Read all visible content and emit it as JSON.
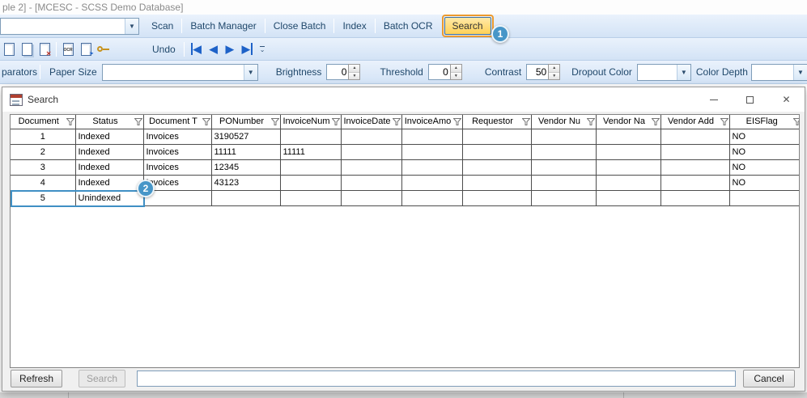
{
  "main_window": {
    "title": "ple 2] - [MCESC - SCSS Demo Database]"
  },
  "toolbar_top": {
    "batch_combo_value": "",
    "scan": "Scan",
    "batch_manager": "Batch Manager",
    "close_batch": "Close Batch",
    "index": "Index",
    "batch_ocr": "Batch OCR",
    "search": "Search"
  },
  "toolbar_pages": {
    "icons": [
      "new-page-icon",
      "insert-page-icon",
      "delete-page-icon",
      "ocr-page-icon",
      "export-page-icon",
      "key-icon"
    ],
    "ocr_icon_label": "OCR",
    "undo": "Undo"
  },
  "toolbar_settings": {
    "separators_label": "parators",
    "paper_size_label": "Paper Size",
    "paper_size_value": "",
    "brightness_label": "Brightness",
    "brightness_value": "0",
    "threshold_label": "Threshold",
    "threshold_value": "0",
    "contrast_label": "Contrast",
    "contrast_value": "50",
    "dropout_color_label": "Dropout Color",
    "dropout_color_value": "",
    "color_depth_label": "Color Depth",
    "color_depth_value": ""
  },
  "callouts": {
    "one": "1",
    "two": "2"
  },
  "dialog": {
    "title": "Search",
    "grid": {
      "columns": [
        "Document",
        "Status",
        "Document T",
        "PONumber",
        "InvoiceNum",
        "InvoiceDate",
        "InvoiceAmo",
        "Requestor",
        "Vendor Nu",
        "Vendor Na",
        "Vendor Add",
        "EISFlag"
      ],
      "rows": [
        [
          "1",
          "Indexed",
          "Invoices",
          "3190527",
          "",
          "",
          "",
          "",
          "",
          "",
          "",
          "NO"
        ],
        [
          "2",
          "Indexed",
          "Invoices",
          "11111",
          "11111",
          "",
          "",
          "",
          "",
          "",
          "",
          "NO"
        ],
        [
          "3",
          "Indexed",
          "Invoices",
          "12345",
          "",
          "",
          "",
          "",
          "",
          "",
          "",
          "NO"
        ],
        [
          "4",
          "Indexed",
          "Invoices",
          "43123",
          "",
          "",
          "",
          "",
          "",
          "",
          "",
          "NO"
        ],
        [
          "5",
          "Unindexed",
          "",
          "",
          "",
          "",
          "",
          "",
          "",
          "",
          "",
          ""
        ]
      ]
    },
    "refresh_button": "Refresh",
    "search_button": "Search",
    "search_input_value": "",
    "cancel_button": "Cancel"
  },
  "colors": {
    "annotation_orange": "#ec9a2e",
    "callout_blue": "#4796c8",
    "toolbar_blue": "#d3e3f6",
    "nav_arrow_blue": "#1e62c8"
  }
}
